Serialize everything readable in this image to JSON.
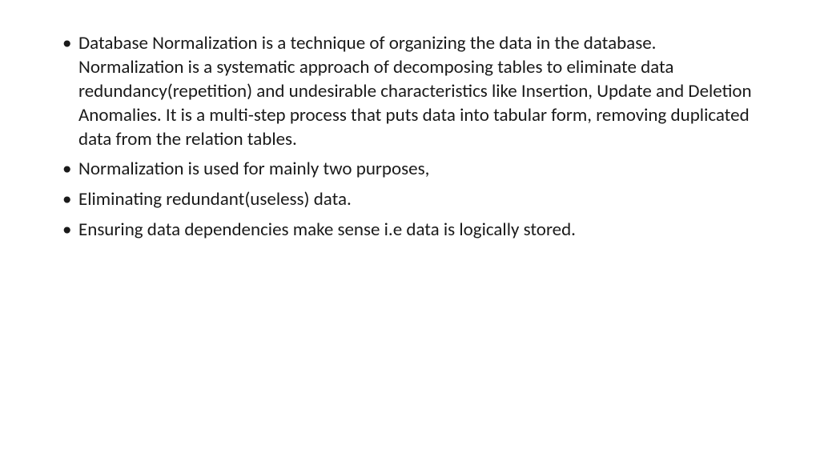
{
  "bullets": [
    "Database Normalization is a technique of organizing the data in the database. Normalization is a systematic approach of decomposing tables to eliminate data redundancy(repetition) and undesirable characteristics like Insertion, Update and Deletion Anomalies. It is a multi-step process that puts data into tabular form, removing duplicated data from the relation tables.",
    "Normalization is used for mainly two purposes,",
    "Eliminating redundant(useless) data.",
    "Ensuring data dependencies make sense i.e data is logically stored."
  ]
}
